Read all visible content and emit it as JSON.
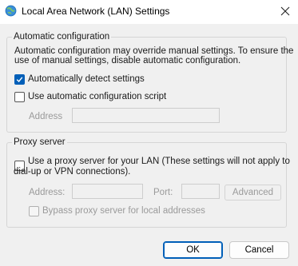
{
  "window": {
    "title": "Local Area Network (LAN) Settings",
    "icon": "network-settings-icon",
    "close_icon": "close-icon"
  },
  "auto_config": {
    "group_label": "Automatic configuration",
    "description_line1": "Automatic configuration may override manual settings.  To ensure the",
    "description_line2": "use of manual settings, disable automatic configuration.",
    "detect_label": "Automatically detect settings",
    "detect_checked": true,
    "script_label": "Use automatic configuration script",
    "script_checked": false,
    "address_label": "Address",
    "address_value": ""
  },
  "proxy": {
    "group_label": "Proxy server",
    "use_proxy_line1": "Use a proxy server for your LAN (These settings will not apply to",
    "use_proxy_line2": "dial-up or VPN connections).",
    "use_proxy_checked": false,
    "address_label": "Address:",
    "address_value": "",
    "port_label": "Port:",
    "port_value": "",
    "advanced_label": "Advanced",
    "bypass_label": "Bypass proxy server for local addresses",
    "bypass_checked": false
  },
  "buttons": {
    "ok": "OK",
    "cancel": "Cancel"
  },
  "colors": {
    "accent": "#005fb8",
    "background": "#f0f0f0"
  }
}
